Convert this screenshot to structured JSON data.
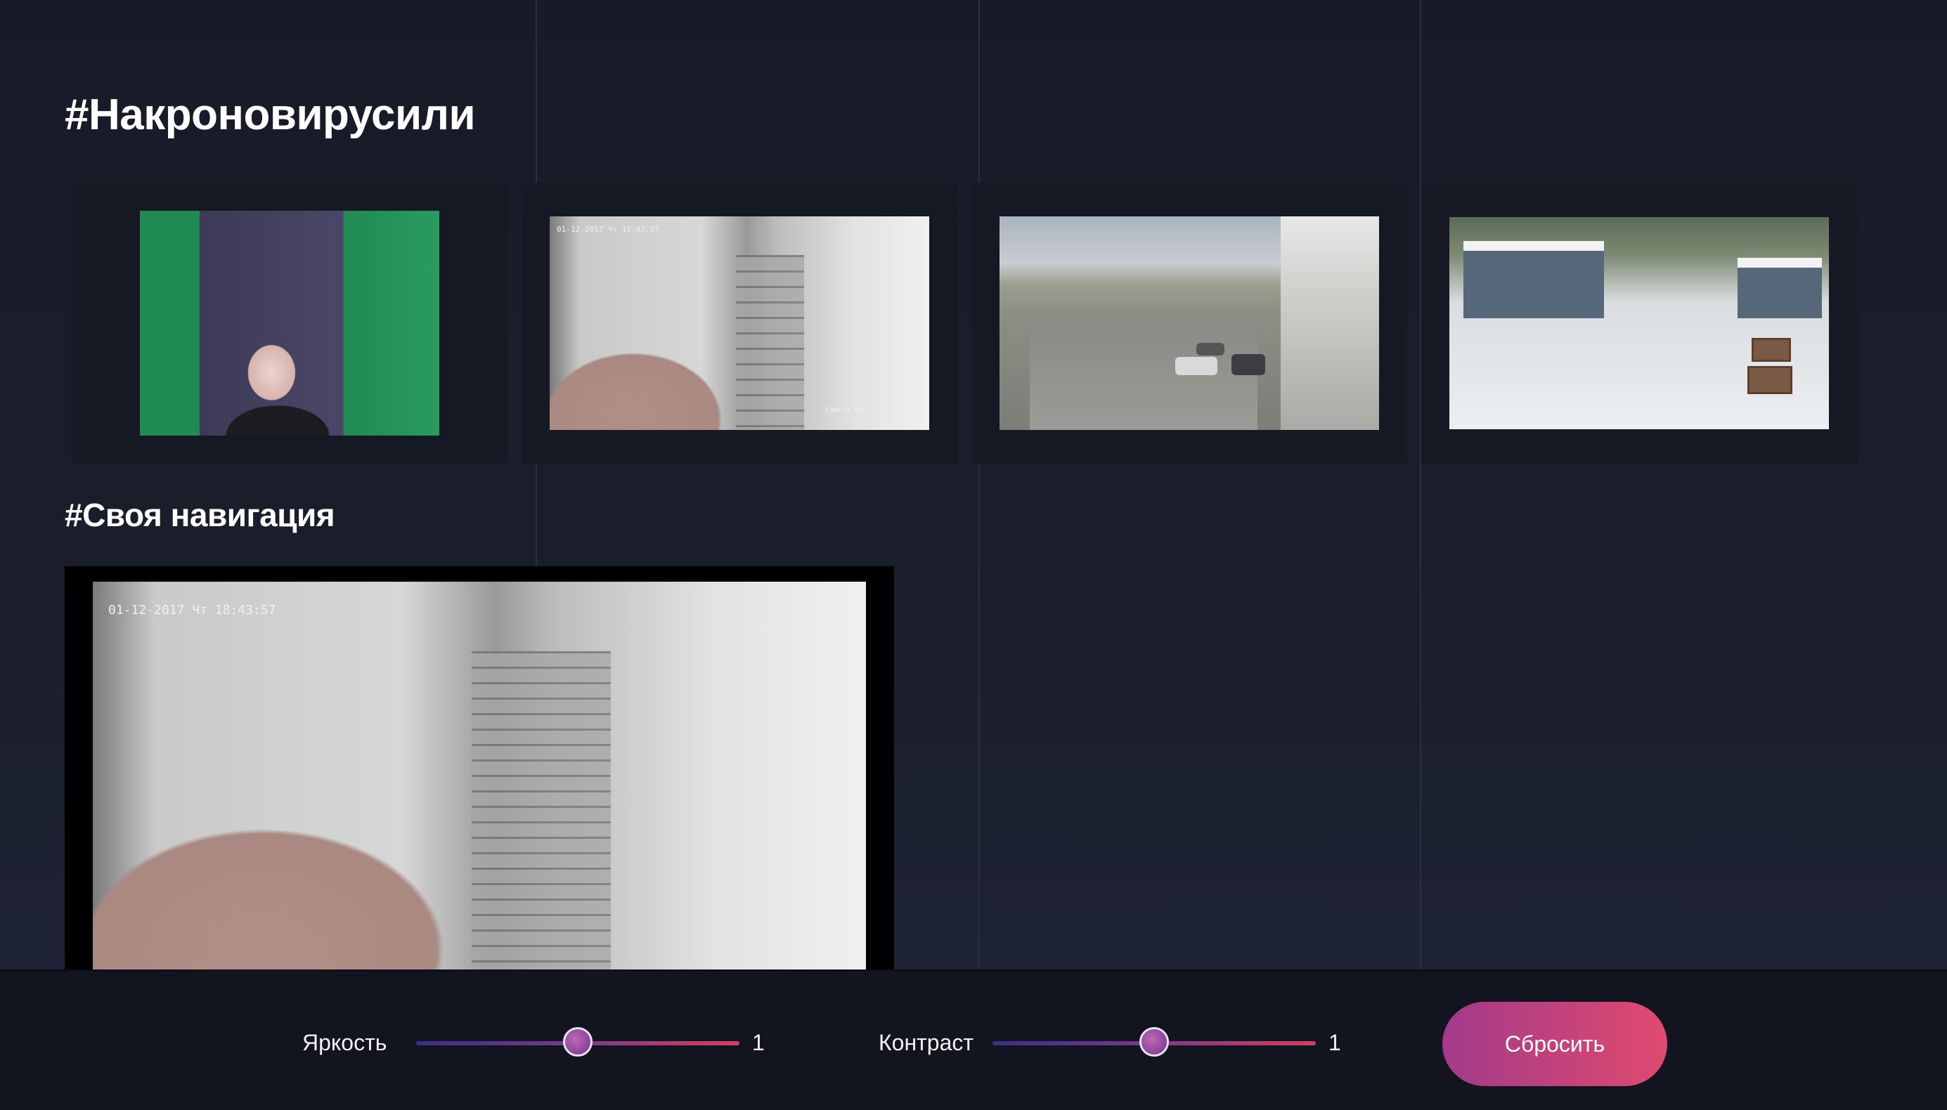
{
  "headings": {
    "cameras": "#Накроновирусили",
    "navigation": "#Своя навигация"
  },
  "feeds": {
    "timestamp_small": "01-12-2017 Чт 18:43:57",
    "camera_label": "Camera 01",
    "timestamp_large": "01-12-2017 Чт 18:43:57"
  },
  "controls": {
    "brightness_label": "Яркость",
    "brightness_value": "1",
    "brightness_level": 0.5,
    "contrast_label": "Контраст",
    "contrast_value": "1",
    "contrast_level": 0.5,
    "reset_label": "Сбросить"
  },
  "colors": {
    "background": "#1b1f2c",
    "tile": "#151924",
    "controlbar": "#121520",
    "accent_start": "#a23a8a",
    "accent_end": "#e04a6e"
  }
}
